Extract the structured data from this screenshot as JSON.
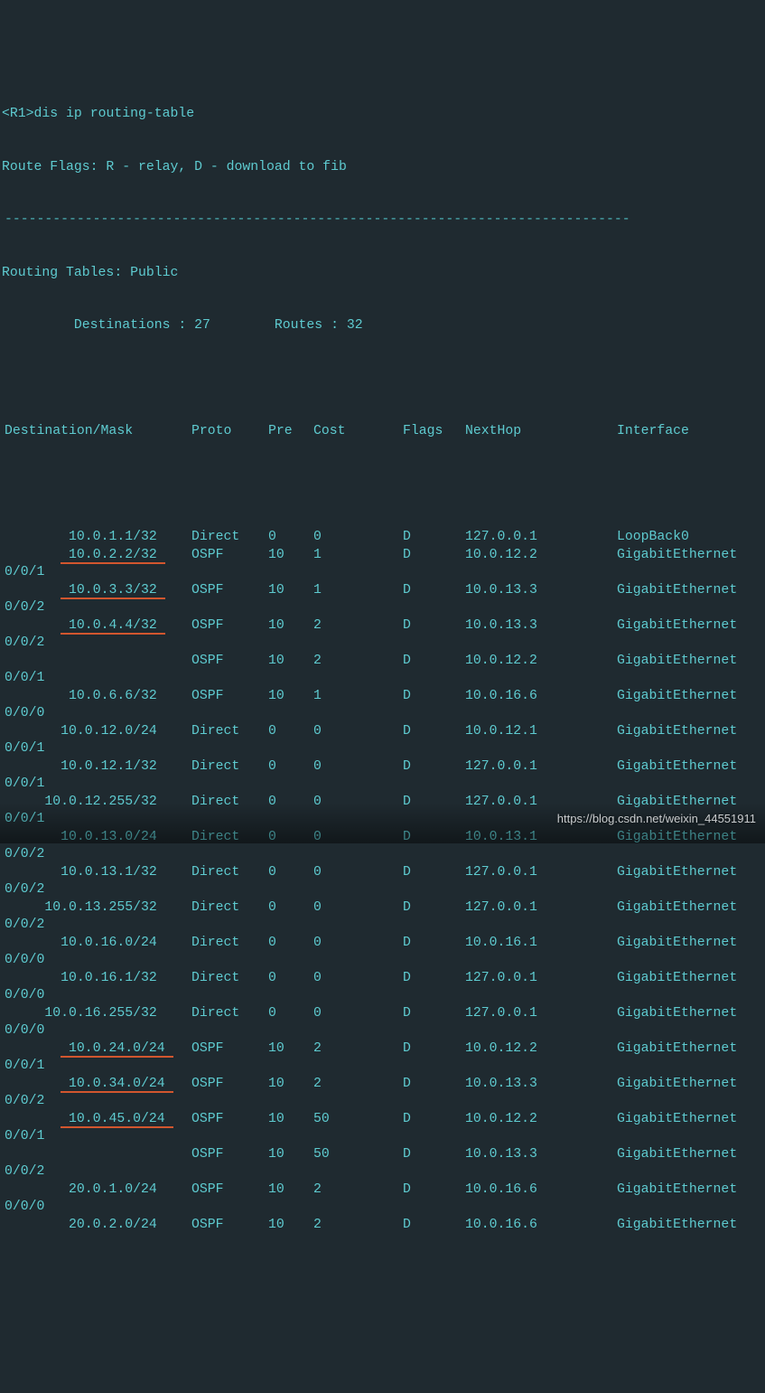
{
  "prompt_prefix": "<R1>",
  "command": "dis ip routing-table",
  "flags_line": "Route Flags: R - relay, D - download to fib",
  "dash_line": "------------------------------------------------------------------------------",
  "tables_line": "Routing Tables: Public",
  "counts_line": "         Destinations : 27        Routes : 32",
  "header": {
    "dest": "Destination/Mask",
    "proto": "Proto",
    "pre": "Pre",
    "cost": "Cost",
    "flags": "Flags",
    "nh": "NextHop",
    "iface": "Interface"
  },
  "rows": [
    {
      "indent": 8,
      "dest": "10.0.1.1/32",
      "proto": "Direct",
      "pre": "0",
      "cost": "0",
      "flags": "D",
      "nh": "127.0.0.1",
      "iface": "LoopBack0",
      "ul": false,
      "wrap": ""
    },
    {
      "indent": 7,
      "dest": " 10.0.2.2/32 ",
      "proto": "OSPF",
      "pre": "10",
      "cost": "1",
      "flags": "D",
      "nh": "10.0.12.2",
      "iface": "GigabitEthernet",
      "ul": true,
      "wrap": "0/0/1"
    },
    {
      "indent": 7,
      "dest": " 10.0.3.3/32 ",
      "proto": "OSPF",
      "pre": "10",
      "cost": "1",
      "flags": "D",
      "nh": "10.0.13.3",
      "iface": "GigabitEthernet",
      "ul": true,
      "wrap": "0/0/2"
    },
    {
      "indent": 7,
      "dest": " 10.0.4.4/32 ",
      "proto": "OSPF",
      "pre": "10",
      "cost": "2",
      "flags": "D",
      "nh": "10.0.13.3",
      "iface": "GigabitEthernet",
      "ul": true,
      "wrap": "0/0/2"
    },
    {
      "indent": 0,
      "dest": "",
      "proto": "OSPF",
      "pre": "10",
      "cost": "2",
      "flags": "D",
      "nh": "10.0.12.2",
      "iface": "GigabitEthernet",
      "ul": false,
      "wrap": "0/0/1"
    },
    {
      "indent": 8,
      "dest": "10.0.6.6/32",
      "proto": "OSPF",
      "pre": "10",
      "cost": "1",
      "flags": "D",
      "nh": "10.0.16.6",
      "iface": "GigabitEthernet",
      "ul": false,
      "wrap": "0/0/0"
    },
    {
      "indent": 7,
      "dest": "10.0.12.0/24",
      "proto": "Direct",
      "pre": "0",
      "cost": "0",
      "flags": "D",
      "nh": "10.0.12.1",
      "iface": "GigabitEthernet",
      "ul": false,
      "wrap": "0/0/1"
    },
    {
      "indent": 7,
      "dest": "10.0.12.1/32",
      "proto": "Direct",
      "pre": "0",
      "cost": "0",
      "flags": "D",
      "nh": "127.0.0.1",
      "iface": "GigabitEthernet",
      "ul": false,
      "wrap": "0/0/1"
    },
    {
      "indent": 5,
      "dest": "10.0.12.255/32",
      "proto": "Direct",
      "pre": "0",
      "cost": "0",
      "flags": "D",
      "nh": "127.0.0.1",
      "iface": "GigabitEthernet",
      "ul": false,
      "wrap": "0/0/1"
    },
    {
      "indent": 7,
      "dest": "10.0.13.0/24",
      "proto": "Direct",
      "pre": "0",
      "cost": "0",
      "flags": "D",
      "nh": "10.0.13.1",
      "iface": "GigabitEthernet",
      "ul": false,
      "wrap": "0/0/2"
    },
    {
      "indent": 7,
      "dest": "10.0.13.1/32",
      "proto": "Direct",
      "pre": "0",
      "cost": "0",
      "flags": "D",
      "nh": "127.0.0.1",
      "iface": "GigabitEthernet",
      "ul": false,
      "wrap": "0/0/2"
    },
    {
      "indent": 5,
      "dest": "10.0.13.255/32",
      "proto": "Direct",
      "pre": "0",
      "cost": "0",
      "flags": "D",
      "nh": "127.0.0.1",
      "iface": "GigabitEthernet",
      "ul": false,
      "wrap": "0/0/2"
    },
    {
      "indent": 7,
      "dest": "10.0.16.0/24",
      "proto": "Direct",
      "pre": "0",
      "cost": "0",
      "flags": "D",
      "nh": "10.0.16.1",
      "iface": "GigabitEthernet",
      "ul": false,
      "wrap": "0/0/0"
    },
    {
      "indent": 7,
      "dest": "10.0.16.1/32",
      "proto": "Direct",
      "pre": "0",
      "cost": "0",
      "flags": "D",
      "nh": "127.0.0.1",
      "iface": "GigabitEthernet",
      "ul": false,
      "wrap": "0/0/0"
    },
    {
      "indent": 5,
      "dest": "10.0.16.255/32",
      "proto": "Direct",
      "pre": "0",
      "cost": "0",
      "flags": "D",
      "nh": "127.0.0.1",
      "iface": "GigabitEthernet",
      "ul": false,
      "wrap": "0/0/0"
    },
    {
      "indent": 7,
      "dest": " 10.0.24.0/24 ",
      "proto": "OSPF",
      "pre": "10",
      "cost": "2",
      "flags": "D",
      "nh": "10.0.12.2",
      "iface": "GigabitEthernet",
      "ul": true,
      "wrap": "0/0/1"
    },
    {
      "indent": 7,
      "dest": " 10.0.34.0/24 ",
      "proto": "OSPF",
      "pre": "10",
      "cost": "2",
      "flags": "D",
      "nh": "10.0.13.3",
      "iface": "GigabitEthernet",
      "ul": true,
      "wrap": "0/0/2"
    },
    {
      "indent": 7,
      "dest": " 10.0.45.0/24 ",
      "proto": "OSPF",
      "pre": "10",
      "cost": "50",
      "flags": "D",
      "nh": "10.0.12.2",
      "iface": "GigabitEthernet",
      "ul": true,
      "wrap": "0/0/1"
    },
    {
      "indent": 0,
      "dest": "",
      "proto": "OSPF",
      "pre": "10",
      "cost": "50",
      "flags": "D",
      "nh": "10.0.13.3",
      "iface": "GigabitEthernet",
      "ul": false,
      "wrap": "0/0/2"
    },
    {
      "indent": 8,
      "dest": "20.0.1.0/24",
      "proto": "OSPF",
      "pre": "10",
      "cost": "2",
      "flags": "D",
      "nh": "10.0.16.6",
      "iface": "GigabitEthernet",
      "ul": false,
      "wrap": "0/0/0"
    },
    {
      "indent": 8,
      "dest": "20.0.2.0/24",
      "proto": "OSPF",
      "pre": "10",
      "cost": "2",
      "flags": "D",
      "nh": "10.0.16.6",
      "iface": "GigabitEthernet",
      "ul": false,
      "wrap": ""
    }
  ],
  "watermark": "https://blog.csdn.net/weixin_44551911"
}
